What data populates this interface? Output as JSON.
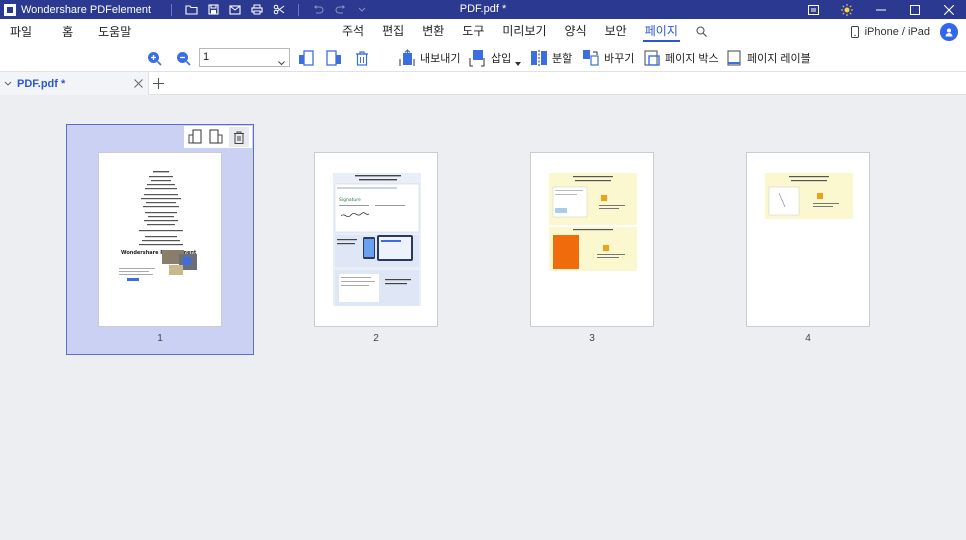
{
  "titlebar": {
    "app_name": "Wondershare PDFelement",
    "doc_title": "PDF.pdf *"
  },
  "menubar": {
    "left": [
      "파일",
      "홈",
      "도움말"
    ],
    "center": [
      "주석",
      "편집",
      "변환",
      "도구",
      "미리보기",
      "양식",
      "보안",
      "페이지"
    ],
    "active": "페이지",
    "device_label": "iPhone / iPad"
  },
  "toolbar": {
    "page_input": "1",
    "export_label": "내보내기",
    "insert_label": "삽입",
    "split_label": "분할",
    "replace_label": "바꾸기",
    "pagebox_label": "페이지 박스",
    "pagelabel_label": "페이지 레이블"
  },
  "tabs": {
    "doc_tab": "PDF.pdf *"
  },
  "pages": {
    "numbers": [
      "1",
      "2",
      "3",
      "4"
    ],
    "p1_title": "Wondershare PDF Element",
    "p2_heading": "Signature"
  },
  "colors": {
    "titlebar_bg": "#2b3990",
    "accent": "#2b57d3",
    "selection_bg": "#cbd1f2"
  }
}
